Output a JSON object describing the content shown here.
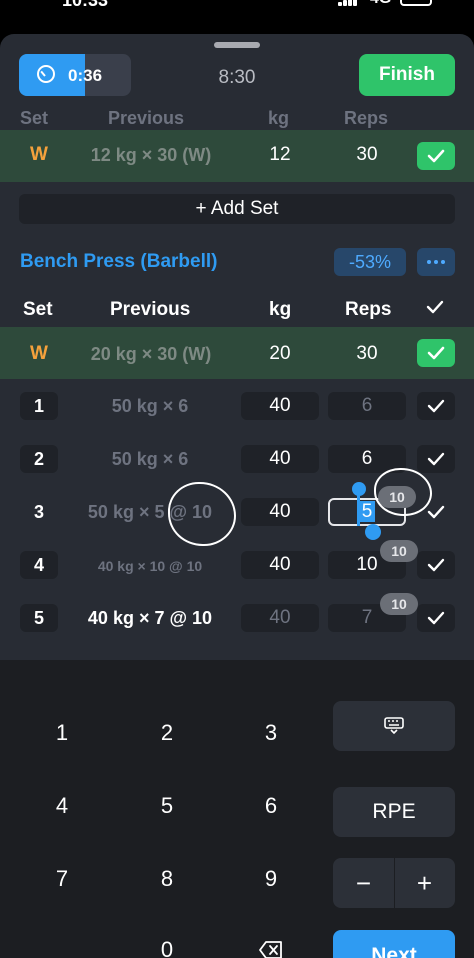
{
  "status": {
    "time": "10:33",
    "network": "4G"
  },
  "timer": {
    "value": "0:36",
    "progress": 0.59
  },
  "elapsed": "8:30",
  "finish_label": "Finish",
  "prev_exercise": {
    "ghost_header": {
      "set": "Set",
      "previous": "Previous",
      "kg": "kg",
      "reps": "Reps"
    },
    "warmup": {
      "set": "W",
      "previous": "12 kg × 30 (W)",
      "kg": "12",
      "reps": "30",
      "done": true
    },
    "add_set": "+ Add Set"
  },
  "exercise": {
    "name": "Bench Press (Barbell)",
    "percent": "-53%",
    "headers": {
      "set": "Set",
      "previous": "Previous",
      "kg": "kg",
      "reps": "Reps"
    },
    "sets": [
      {
        "set": "W",
        "previous": "20 kg × 30 (W)",
        "kg": "20",
        "reps": "30",
        "done": true
      },
      {
        "set": "1",
        "previous": "50 kg × 6",
        "kg": "40",
        "reps": "6",
        "done": false
      },
      {
        "set": "2",
        "previous": "50 kg × 6",
        "kg": "40",
        "reps": "6",
        "done": false
      },
      {
        "set": "3",
        "previous": "50 kg × 5 @ 10",
        "kg": "40",
        "reps": "5",
        "done": false,
        "rpe": "10"
      },
      {
        "set": "4",
        "previous": "40 kg × 10 @ 10",
        "kg": "40",
        "reps": "10",
        "done": false,
        "rpe": "10"
      },
      {
        "set": "5",
        "previous": "40 kg × 7 @ 10",
        "kg": "40",
        "reps": "7",
        "done": false,
        "rpe": "10"
      }
    ]
  },
  "keypad": {
    "keys": [
      "1",
      "2",
      "3",
      "4",
      "5",
      "6",
      "7",
      "8",
      "9",
      "0"
    ],
    "rpe_label": "RPE",
    "minus": "−",
    "plus": "+",
    "next_label": "Next"
  },
  "colors": {
    "accent": "#2f9bf2",
    "success": "#2fc46a",
    "warmup": "#f4a13c",
    "background": "#282c34"
  }
}
